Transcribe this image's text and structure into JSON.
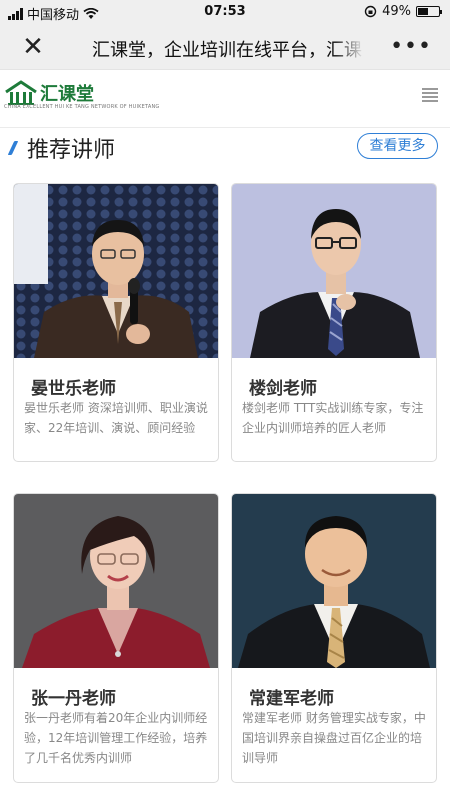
{
  "status_bar": {
    "carrier": "中国移动",
    "time": "07:53",
    "battery": "49%",
    "battery_level": 0.49
  },
  "nav": {
    "title": "汇课堂，企业培训在线平台，汇课",
    "more": "•••"
  },
  "site": {
    "logo_text": "汇课堂",
    "logo_sub": "CHINA EXCELLENT HUI KE TANG NETWORK OF HUIKETANG"
  },
  "section": {
    "title": "推荐讲师",
    "more_label": "查看更多"
  },
  "teachers": [
    {
      "name": "晏世乐老师",
      "desc": "晏世乐老师 资深培训师、职业演说家、22年培训、演说、顾问经验"
    },
    {
      "name": "楼剑老师",
      "desc": "楼剑老师 TTT实战训练专家，专注企业内训师培养的匠人老师"
    },
    {
      "name": "张一丹老师",
      "desc": "张一丹老师有着20年企业内训师经验，12年培训管理工作经验，培养了几千名优秀内训师"
    },
    {
      "name": "常建军老师",
      "desc": "常建军老师 财务管理实战专家，中国培训界亲自操盘过百亿企业的培训导师"
    }
  ],
  "colors": {
    "accent": "#2f7fd6",
    "logo_green": "#1e7b3a",
    "nav_bg": "#efefef"
  }
}
